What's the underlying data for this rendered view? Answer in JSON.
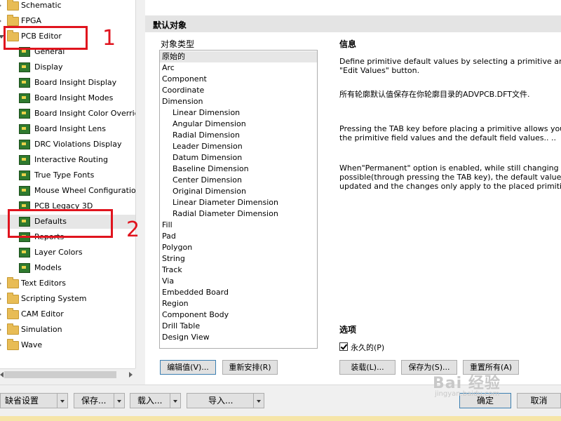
{
  "tree": {
    "folders_top": [
      {
        "label": "Schematic"
      },
      {
        "label": "FPGA"
      },
      {
        "label": "PCB Editor"
      }
    ],
    "pcb_children": [
      {
        "label": "General"
      },
      {
        "label": "Display"
      },
      {
        "label": "Board Insight Display"
      },
      {
        "label": "Board Insight Modes"
      },
      {
        "label": "Board Insight Color Overrid"
      },
      {
        "label": "Board Insight Lens"
      },
      {
        "label": "DRC Violations Display"
      },
      {
        "label": "Interactive Routing"
      },
      {
        "label": "True Type Fonts"
      },
      {
        "label": "Mouse Wheel Configuration"
      },
      {
        "label": "PCB Legacy 3D"
      },
      {
        "label": "Defaults"
      },
      {
        "label": "Reports"
      },
      {
        "label": "Layer Colors"
      },
      {
        "label": "Models"
      }
    ],
    "folders_bottom": [
      {
        "label": "Text Editors"
      },
      {
        "label": "Scripting System"
      },
      {
        "label": "CAM Editor"
      },
      {
        "label": "Simulation"
      },
      {
        "label": "Wave"
      }
    ]
  },
  "annotations": {
    "num1": "1",
    "num2": "2"
  },
  "panel": {
    "title": "默认对象",
    "type_label": "对象类型",
    "types": [
      {
        "label": "原始的",
        "indent": 0
      },
      {
        "label": "Arc",
        "indent": 0
      },
      {
        "label": "Component",
        "indent": 0
      },
      {
        "label": "Coordinate",
        "indent": 0
      },
      {
        "label": "Dimension",
        "indent": 0
      },
      {
        "label": "Linear Dimension",
        "indent": 1
      },
      {
        "label": "Angular Dimension",
        "indent": 1
      },
      {
        "label": "Radial Dimension",
        "indent": 1
      },
      {
        "label": "Leader Dimension",
        "indent": 1
      },
      {
        "label": "Datum Dimension",
        "indent": 1
      },
      {
        "label": "Baseline Dimension",
        "indent": 1
      },
      {
        "label": "Center Dimension",
        "indent": 1
      },
      {
        "label": "Original Dimension",
        "indent": 1
      },
      {
        "label": "Linear Diameter Dimension",
        "indent": 1
      },
      {
        "label": "Radial Diameter Dimension",
        "indent": 1
      },
      {
        "label": "Fill",
        "indent": 0
      },
      {
        "label": "Pad",
        "indent": 0
      },
      {
        "label": "Polygon",
        "indent": 0
      },
      {
        "label": "String",
        "indent": 0
      },
      {
        "label": "Track",
        "indent": 0
      },
      {
        "label": "Via",
        "indent": 0
      },
      {
        "label": "Embedded Board",
        "indent": 0
      },
      {
        "label": "Region",
        "indent": 0
      },
      {
        "label": "Component Body",
        "indent": 0
      },
      {
        "label": "Drill Table",
        "indent": 0
      },
      {
        "label": "Design View",
        "indent": 0
      }
    ],
    "info_title": "信息",
    "info_p1": "Define primitive default values by selecting a primitive and clic\n\"Edit Values\" button.",
    "info_p2": "所有轮廓默认值保存在你轮廓目录的ADVPCB.DFT文件.",
    "info_p3": "Pressing the TAB key before placing a primitive allows you to e\nthe primitive field values and the default field values.. ..",
    "info_p4": "When\"Permanent\" option is enabled, while still changing field\npossible(through pressing the TAB key), the default values are\nupdated and the changes only apply to the placed primitive.",
    "options_title": "选项",
    "permanent_label": "永久的(P)",
    "permanent_checked": true,
    "edit_values_btn": "编辑值(V)...",
    "reorder_btn": "重新安排(R)",
    "load_btn": "装载(L)...",
    "save_as_btn": "保存为(S)...",
    "reset_all_btn": "重置所有(A)"
  },
  "bottom": {
    "default_settings": "缺省设置",
    "save": "保存...",
    "load": "载入...",
    "import": "导入...",
    "ok": "确定",
    "cancel": "取消"
  },
  "watermark": {
    "text": "Bai 经验",
    "url": "jingyan.baidu.com"
  },
  "colors": {
    "annotation_red": "#e0141e"
  }
}
